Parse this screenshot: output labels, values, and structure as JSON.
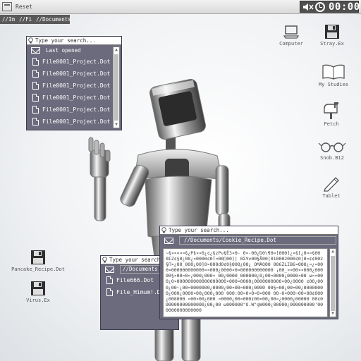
{
  "topbar": {
    "reset_label": "Reset",
    "clock_time": "00:00"
  },
  "path_segments": [
    "//Im",
    "//Fi",
    "//Documents"
  ],
  "window1": {
    "search_placeholder": "Type your search...",
    "header_label": "Last opened",
    "files": [
      "File0001_Project.Dot",
      "File0001_Project.Dot",
      "File0001_Project.Dot",
      "File0001_Project.Dot",
      "File0001_Project.Dot",
      "File0001_Project.Dot"
    ]
  },
  "window2": {
    "search_placeholder": "Type your search...",
    "path": "//Documents",
    "files": [
      "File666.Dot",
      "File_Himum!.Dot"
    ]
  },
  "window3": {
    "search_placeholder": "Type your search...",
    "path": "//Documents/Cookie_Recipe.Dot",
    "content": "~§¤¤¤¤¤§¿Ρ§¤¤Θ¿¢¿§zΡν§Ê3¤Θ- Θ¤-ΘΘ¿ΌΘ\\¶Θ¤[ΘΘΘ]¿¤§[¿Θ¤¤§ΘΘ ΘΣZ¢§Θ¿Θ8¿¤ΘΘΘΘ¢Θΐ¤ΘΘ∏ΘΘ]| ΘΣ¥νΘΘ§ÃΘΘ[Θ1ΘΘΘ2ΘΘΘ¢Θ]Θ¤¢¢ΘΘ2§Π¤¿ΘΘ_ΘΘΘ¿ΘΘ]Θ¤ΘΘΘdΘ¢Θ§ΘΘΘ¿ΘΘ¿ ΟΜÄQΘΘ ΘΘ6ΖLΙΒ6¤ΘΘΘ¿¤¿¤ΘΘΘ¤ΘΘΘΘΘΘΘΘΘΘΘΘ¤¤ΘΘΘ¿ΘΘΘΘ¤Θ¤ΘΘΘΘΘΘΘΘΘΘΘΘ ¡ΘΘ_¤¤ΘΘ¤¤ΘΘΘ¿ΘΘΘΘΘ§¤ΘΘ¤Θ¤¿ΘΘΘ¿ΘΘΘ¤_ΘΘ¿ΘΘΘΘ_ΘΘΘΘΘΘ¿Θ¿ΘΘ¤ΘΘΘΘ¿ΘΘΘΘ¤ΘΘ ω¤¤ΘΘΘ¿Θ¤ΘΘΘΘΘΘΘΘΘΘΘΘΘΘΘΘΘΘ¤ΘΘΘ¤ΘΘΘΘ¿ΘΘΘΘΘΘΘΘΘΘ¤ΘΘ¿ΘΘΘΘ ¢ΘΘ¿ΘΘΘ¿ΘΘ~¿ΘΘ¤ΘΘΘΘΘΘΘ¿ΘΘΘΘ¿ΘΘ¤ΘΘ¤ΘΘΘ¿ΘΘΘΘ ΘΘ§¤ΘΘ¿ΘΘ¤ΘΘ¿ΘΘΘΘΘΘΘΘ¿ΘΘΘ¿ΘΘΘΘ¤ΘΘ¿ΘΘΘ¿ΘΘΘ ΘΘΘ:ΘΘ¤Θ¤Θ¤Θ¤ΘΘΘ ΘΘ-Θ¤ΘΘΘ~ΘΘ¤ΘΘ¢ΘΘΘ¿ΘΘ8ΘΘΘ ¤ΘΘ¤ΘΘ¿ΘΘΘ ¤ΘΘΘΘ¿ΘΘ¤ΘΘΘ¢ΘΘ¤ΘΘ¿ΘΘ¤¿ΘΘΘΘ¿ΘΘΘΘΘ ΘΘ¢Θ ΘΘΘΘΘΘΘΘΘΘΘΘΘΘ¿ΘΘ¿ΘΘ ωΘΘΘΘΘΘ\"O.W\"gWΘΘΘ¿ΘΘΘΘΘ¿ΘΘΘΘΘΘΘΘΘ'ΘΘΘΘΘΘΘΘΘΘΘΘΘΘΘ"
  },
  "desktop_icons": {
    "computer": "Computer",
    "stray": "Stray.Ex",
    "studies": "My Studies",
    "fetch": "Fetch",
    "snob": "Snob.B12",
    "tablet": "Tablet",
    "pancake": "Pancake_Recipe.Dot",
    "virus": "Virus.Ex"
  }
}
